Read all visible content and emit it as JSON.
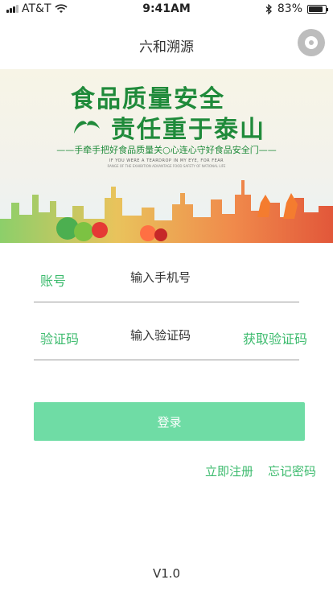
{
  "status_bar": {
    "carrier": "AT&T",
    "time": "9:41AM",
    "battery": "83%",
    "battery_level": 0.83
  },
  "nav": {
    "title": "六和溯源"
  },
  "banner": {
    "headline_1": "食品质量安全",
    "headline_2": "责任重于泰山",
    "slogan": "——手牵手把好食品质量关○心连心守好食品安全门——",
    "english_line": "IF YOU WERE A TEARDROP IN MY EYE, FOR FEAR",
    "english_small": "RANGE OF THE EXHIBITION ADVANTAGE FOOD SAFETY OF NATIONAL LIFE"
  },
  "form": {
    "account_label": "账号",
    "account_placeholder": "输入手机号",
    "code_label": "验证码",
    "code_placeholder": "输入验证码",
    "get_code_label": "获取验证码"
  },
  "actions": {
    "login_label": "登录",
    "register_label": "立即注册",
    "forgot_label": "忘记密码"
  },
  "footer": {
    "version": "V1.0"
  },
  "colors": {
    "accent": "#3dbb6e",
    "button": "#6fdca5",
    "banner_green": "#1f8a3a"
  },
  "icons": [
    "signal-icon",
    "wifi-icon",
    "bluetooth-icon",
    "battery-icon",
    "capsule-icon"
  ]
}
